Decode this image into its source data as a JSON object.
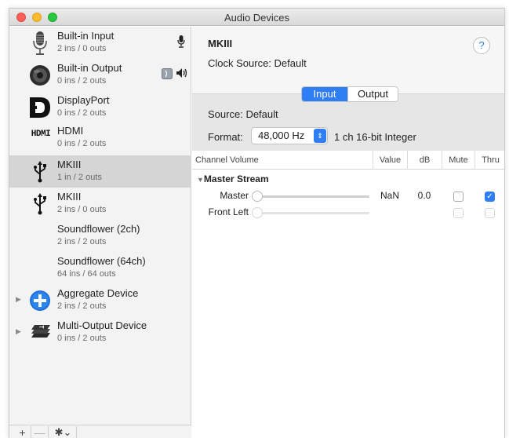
{
  "window": {
    "title": "Audio Devices"
  },
  "sidebar": {
    "devices": [
      {
        "name": "Built-in Input",
        "sub": "2 ins / 0 outs",
        "icon": "microphone-icon",
        "indicator": "microphone-indicator-icon"
      },
      {
        "name": "Built-in Output",
        "sub": "0 ins / 2 outs",
        "icon": "speaker-icon",
        "indicator": "finder-speaker-indicator-icon"
      },
      {
        "name": "DisplayPort",
        "sub": "0 ins / 2 outs",
        "icon": "displayport-icon"
      },
      {
        "name": "HDMI",
        "sub": "0 ins / 2 outs",
        "icon": "hdmi-logo-icon",
        "icon_text": "HDMI"
      },
      {
        "name": "MKIII",
        "sub": "1 in / 2 outs",
        "icon": "usb-icon",
        "selected": true
      },
      {
        "name": "MKIII",
        "sub": "2 ins / 0 outs",
        "icon": "usb-icon"
      },
      {
        "name": "Soundflower (2ch)",
        "sub": "2 ins / 2 outs"
      },
      {
        "name": "Soundflower (64ch)",
        "sub": "64 ins / 64 outs"
      },
      {
        "name": "Aggregate Device",
        "sub": "2 ins / 2 outs",
        "icon": "aggregate-plus-icon"
      },
      {
        "name": "Multi-Output Device",
        "sub": "0 ins / 2 outs",
        "icon": "multi-output-stack-icon"
      }
    ],
    "bottom": {
      "plus": "+",
      "minus": "—",
      "gear": "✱⌄"
    }
  },
  "main": {
    "device_title": "MKIII",
    "help": "?",
    "clock_source_label": "Clock Source:",
    "clock_source_value": "Default",
    "segments": {
      "input": "Input",
      "output": "Output",
      "active": "Input"
    },
    "source_label": "Source:",
    "source_value": "Default",
    "format_label": "Format:",
    "format_value": "48,000 Hz",
    "format_desc": "1 ch 16-bit Integer",
    "table": {
      "headers": {
        "channel": "Channel Volume",
        "value": "Value",
        "db": "dB",
        "mute": "Mute",
        "thru": "Thru"
      },
      "group": "Master Stream",
      "rows": [
        {
          "name": "Master",
          "value": "NaN",
          "db": "0.0",
          "mute": false,
          "thru": true,
          "enabled": true
        },
        {
          "name": "Front Left",
          "value": "",
          "db": "",
          "mute": false,
          "thru": false,
          "enabled": false
        }
      ]
    }
  },
  "colors": {
    "accent": "#2f7ef3",
    "selection": "#d5d5d5"
  }
}
